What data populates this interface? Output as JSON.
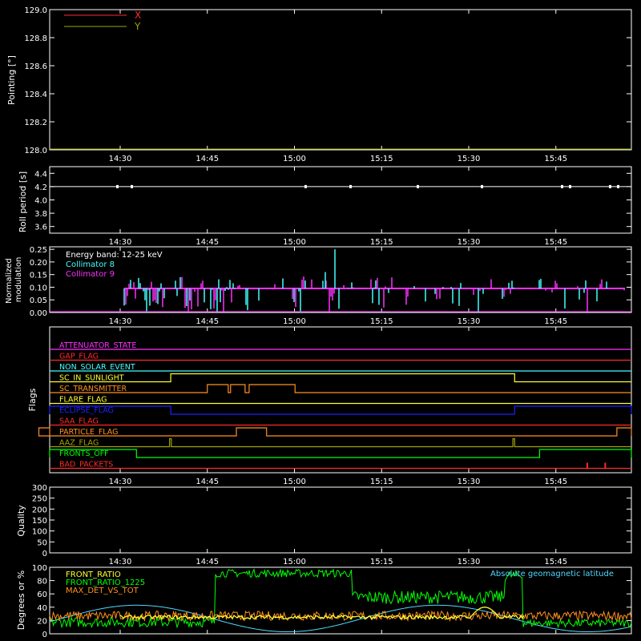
{
  "colors": {
    "background": "#000000",
    "axis": "#ffffff",
    "red": "#ff2a2a",
    "olive": "#a4a400",
    "cyan": "#40ffff",
    "magenta": "#ff30ff",
    "green": "#00ff00",
    "orange": "#ff9020",
    "yellow": "#ffff30",
    "blue": "#2020ff",
    "lightcyan": "#50d8ff"
  },
  "time_axis": {
    "start_min": 870,
    "end_min": 972,
    "ticks": [
      {
        "min": 870,
        "label": "14:30"
      },
      {
        "min": 885,
        "label": "14:45"
      },
      {
        "min": 900,
        "label": "15:00"
      },
      {
        "min": 915,
        "label": "15:15"
      },
      {
        "min": 930,
        "label": "15:30"
      },
      {
        "min": 945,
        "label": "15:45"
      }
    ]
  },
  "chart_data": [
    {
      "type": "line",
      "id": "pointing",
      "ylabel": "Pointing [°]",
      "ylim": [
        128.0,
        129.0
      ],
      "yticks": [
        "128.0",
        "128.2",
        "128.4",
        "128.6",
        "128.8",
        "129.0"
      ],
      "series": [
        {
          "name": "X",
          "color": "#ff2a2a",
          "y": [
            128.0,
            128.0
          ]
        },
        {
          "name": "Y",
          "color": "#a4a400",
          "y": [
            128.0,
            128.0
          ]
        }
      ],
      "legend": "top-left"
    },
    {
      "type": "line",
      "id": "roll",
      "ylabel": "Roll period [s]",
      "ylim": [
        3.5,
        4.5
      ],
      "yticks": [
        "3.6",
        "3.8",
        "4.0",
        "4.2",
        "4.4"
      ],
      "series": [
        {
          "name": "",
          "color": "#ffffff",
          "value": 4.2
        }
      ]
    },
    {
      "type": "bar",
      "id": "modulation",
      "ylabel": "Normalized modulation",
      "ylim": [
        0,
        0.26
      ],
      "yticks": [
        "0.00",
        "0.05",
        "0.10",
        "0.15",
        "0.20",
        "0.25"
      ],
      "annotation": "Energy band: 12-25 keV",
      "series": [
        {
          "name": "Collimator 8",
          "color": "#40ffff",
          "baseline": 0.095
        },
        {
          "name": "Collimator 9",
          "color": "#ff30ff",
          "baseline": 0.095
        }
      ],
      "x_range_min": [
        870,
        958
      ]
    },
    {
      "type": "line",
      "id": "flags",
      "ylabel": "Flags",
      "flags": [
        {
          "name": "ATTENUATOR_STATE",
          "color": "#ff30ff",
          "steps": []
        },
        {
          "name": "GAP_FLAG",
          "color": "#ff2a2a",
          "steps": []
        },
        {
          "name": "NON_SOLAR_EVENT",
          "color": "#40ffff",
          "steps": []
        },
        {
          "name": "SC_IN_SUNLIGHT",
          "color": "#ffff30",
          "steps": [
            [
              878.7,
              937.9
            ]
          ]
        },
        {
          "name": "SC_TRANSMITTER",
          "color": "#ff9020",
          "steps": [
            [
              885,
              888.6
            ],
            [
              889,
              891.5
            ],
            [
              892.2,
              900.1
            ]
          ]
        },
        {
          "name": "FLARE_FLAG",
          "color": "#ffff30",
          "steps": []
        },
        {
          "name": "ECLIPSE_FLAG",
          "color": "#2020ff",
          "steps": [
            [
              853,
              878.7
            ],
            [
              937.9,
              975
            ]
          ]
        },
        {
          "name": "SAA_FLAG",
          "color": "#ff2a2a",
          "steps": []
        },
        {
          "name": "PARTICLE_FLAG",
          "color": "#ff9020",
          "steps": [
            [
              853,
              856
            ],
            [
              890,
              895.2
            ],
            [
              955.5,
              962.5
            ]
          ]
        },
        {
          "name": "AAZ_FLAG",
          "color": "#a4a400",
          "steps": [
            [
              878.5,
              878.8
            ],
            [
              937.6,
              937.9
            ]
          ]
        },
        {
          "name": "FRONTS_OFF",
          "color": "#00ff00",
          "steps": [
            [
              853,
              872.8
            ],
            [
              942.2,
              975
            ]
          ]
        },
        {
          "name": "BAD_PACKETS",
          "color": "#ff2a2a",
          "steps": [],
          "spikes": [
            950.4,
            953.5
          ]
        }
      ]
    },
    {
      "type": "line",
      "id": "quality",
      "ylabel": "Quality",
      "ylim": [
        0,
        300
      ],
      "yticks": [
        "0",
        "50",
        "100",
        "150",
        "200",
        "250",
        "300"
      ],
      "series": []
    },
    {
      "type": "line",
      "id": "ratios",
      "ylabel": "Degrees or %",
      "ylim": [
        0,
        100
      ],
      "yticks": [
        "0",
        "20",
        "40",
        "60",
        "80",
        "100"
      ],
      "series": [
        {
          "name": "FRONT_RATIO",
          "color": "#ffff30"
        },
        {
          "name": "FRONT_RATIO_1225",
          "color": "#00ff00"
        },
        {
          "name": "MAX_DET_VS_TOT",
          "color": "#ff9020"
        },
        {
          "name": "Absolute geomagnetic latitude",
          "color": "#50d8ff"
        }
      ]
    }
  ]
}
